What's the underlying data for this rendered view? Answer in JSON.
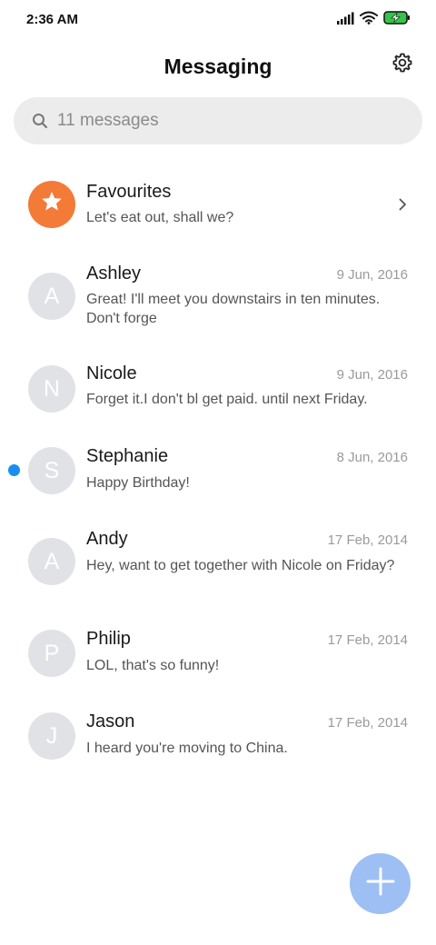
{
  "status_bar": {
    "time": "2:36 AM",
    "icons": [
      "signal-icon",
      "wifi-icon",
      "battery-charging-icon"
    ]
  },
  "header": {
    "title": "Messaging",
    "settings_icon": "gear-icon"
  },
  "search": {
    "placeholder": "11 messages",
    "icon": "search-icon"
  },
  "colors": {
    "favourite_avatar": "#f47a38",
    "avatar": "#e1e2e6",
    "unread_dot": "#1a8ef0",
    "fab": "#9dbff3",
    "battery": "#35c34a"
  },
  "conversations": [
    {
      "name": "Favourites",
      "preview": "Let's eat out, shall we?",
      "icon": "star-icon",
      "trailing": "chevron-right-icon"
    },
    {
      "name": "Ashley",
      "initial": "A",
      "date": "9 Jun, 2016",
      "preview": "Great! I'll meet you downstairs in ten minutes. Don't forge"
    },
    {
      "name": "Nicole",
      "initial": "N",
      "date": "9 Jun, 2016",
      "preview": "Forget it.I don't bl get paid. until next Friday."
    },
    {
      "name": "Stephanie",
      "initial": "S",
      "date": "8 Jun, 2016",
      "preview": "Happy Birthday!",
      "unread": true
    },
    {
      "name": "Andy",
      "initial": "A",
      "date": "17 Feb, 2014",
      "preview": "Hey, want to get together with Nicole on Friday?"
    },
    {
      "name": "Philip",
      "initial": "P",
      "date": "17 Feb, 2014",
      "preview": "LOL, that's so funny!"
    },
    {
      "name": "Jason",
      "initial": "J",
      "date": "17 Feb, 2014",
      "preview": "I heard you're moving to China."
    }
  ],
  "fab": {
    "icon": "plus-icon"
  }
}
